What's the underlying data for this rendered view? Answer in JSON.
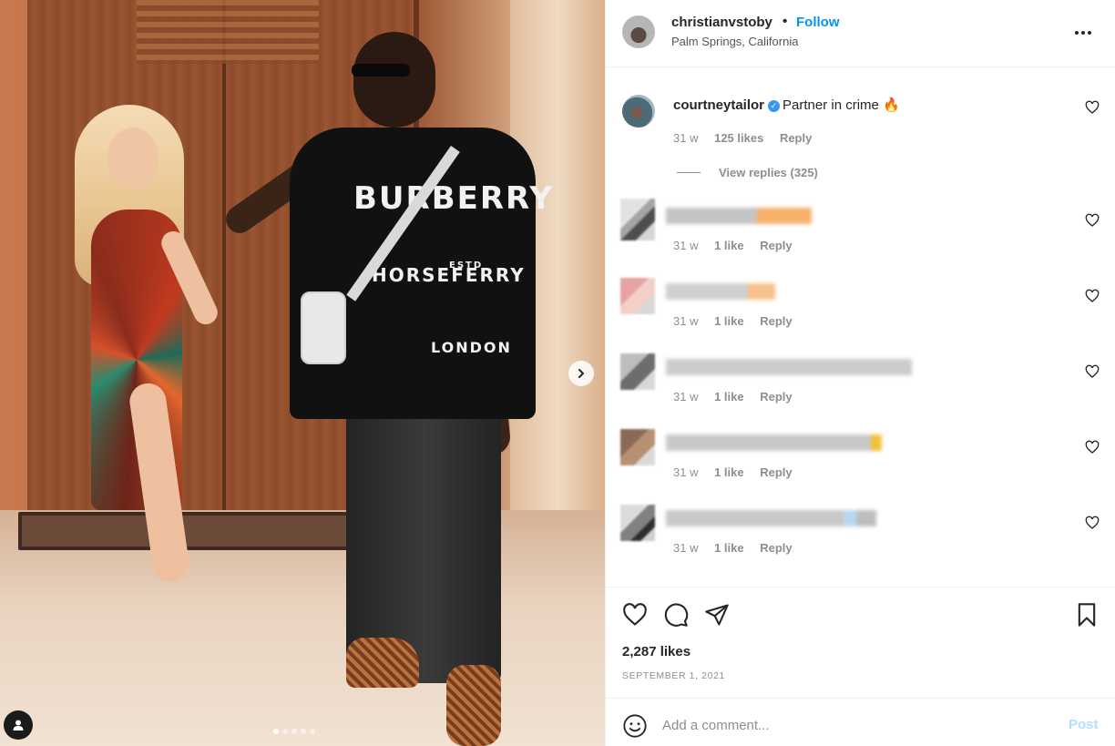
{
  "post": {
    "author": "christianvstoby",
    "separator": "•",
    "follow_label": "Follow",
    "location": "Palm Springs, California",
    "more_label": "•••",
    "photo_count": 5,
    "active_photo": 1,
    "shirt_text": {
      "line1": "BURBERRY",
      "line2": "HORSEFERRY",
      "line3": "ESTD",
      "line4": "LONDON"
    }
  },
  "top_comment": {
    "username": "courtneytailor",
    "verified": true,
    "text": "Partner in crime 🔥",
    "time": "31 w",
    "likes": "125 likes",
    "reply_label": "Reply",
    "view_replies": "View replies (325)"
  },
  "replies": [
    {
      "time": "31 w",
      "likes": "1 like",
      "reply_label": "Reply",
      "text_redacted": true
    },
    {
      "time": "31 w",
      "likes": "1 like",
      "reply_label": "Reply",
      "text_redacted": true
    },
    {
      "time": "31 w",
      "likes": "1 like",
      "reply_label": "Reply",
      "text_redacted": true
    },
    {
      "time": "31 w",
      "likes": "1 like",
      "reply_label": "Reply",
      "text_redacted": true
    },
    {
      "time": "31 w",
      "likes": "1 like",
      "reply_label": "Reply",
      "text_redacted": true
    }
  ],
  "stats": {
    "likes": "2,287 likes",
    "date": "SEPTEMBER 1, 2021"
  },
  "composer": {
    "placeholder": "Add a comment...",
    "post_label": "Post"
  },
  "icons": {
    "like": "heart-icon",
    "comment": "comment-bubble-icon",
    "share": "paper-plane-icon",
    "save": "bookmark-icon",
    "emoji": "smiley-icon",
    "next": "chevron-right-icon",
    "tags": "user-tag-icon"
  },
  "colors": {
    "link_blue": "#0095f6",
    "post_disabled": "#b2dffc",
    "verified": "#3897f0",
    "muted_text": "#8e8e8e"
  }
}
